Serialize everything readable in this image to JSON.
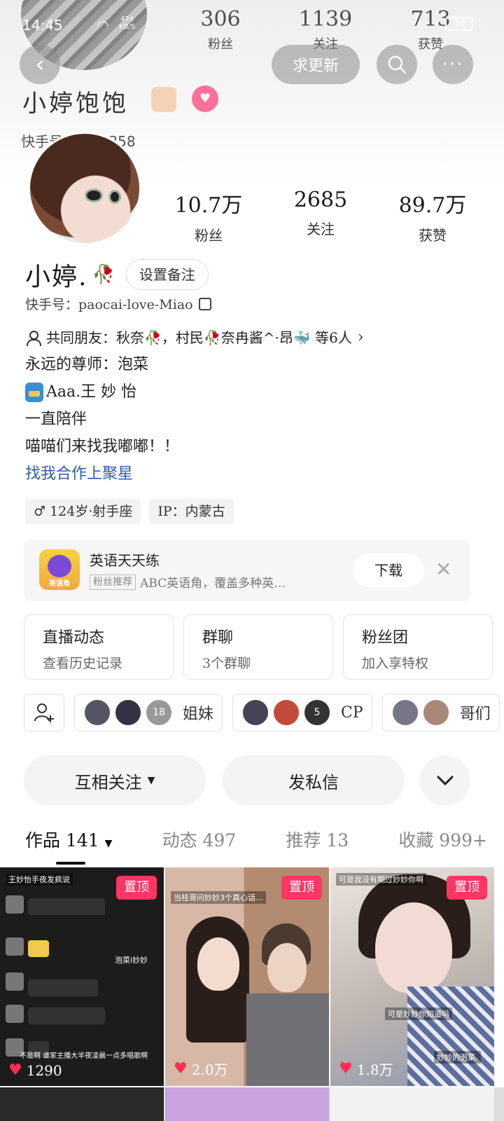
{
  "status_bar": {
    "time": "14:45",
    "speed_value": "424",
    "speed_unit": "KB/S",
    "battery": "36"
  },
  "header_bg": {
    "stats": [
      {
        "value": "306",
        "label": "粉丝"
      },
      {
        "value": "1139",
        "label": "关注"
      },
      {
        "value": "713",
        "label": "获赞"
      }
    ],
    "name": "小婷饱饱",
    "id_text": "快手号：…01358"
  },
  "nav": {
    "update_label": "求更新"
  },
  "profile": {
    "stats": [
      {
        "value": "10.7万",
        "label": "粉丝"
      },
      {
        "value": "2685",
        "label": "关注"
      },
      {
        "value": "89.7万",
        "label": "获赞"
      }
    ],
    "name": "小婷.",
    "remark_label": "设置备注",
    "kuaishou_id": "快手号：paocai-love-Miao"
  },
  "bio": {
    "mutual_friends": "共同朋友：秋奈🥀，村民🥀奈冉酱^·昂🐳 等6人",
    "lines": [
      "永远的尊师：泡菜",
      "Aaa.王 妙 怡",
      "一直陪伴",
      "喵喵们来找我嘟嘟！！"
    ],
    "link": "找我合作上聚星"
  },
  "tags": [
    "124岁·射手座",
    "IP：内蒙古"
  ],
  "ad": {
    "app_icon_label": "英语角",
    "title": "英语天天练",
    "badge": "粉丝推荐",
    "subtitle": "ABC英语角，覆盖多种英…",
    "download_label": "下载"
  },
  "cards": [
    {
      "title": "直播动态",
      "sub": "查看历史记录"
    },
    {
      "title": "群聊",
      "sub": "3个群聊"
    },
    {
      "title": "粉丝团",
      "sub": "加入享特权"
    }
  ],
  "chips": [
    {
      "label": "姐妹",
      "extra": "18"
    },
    {
      "label": "CP",
      "extra": "5"
    },
    {
      "label": "哥们"
    }
  ],
  "actions": {
    "follow_label": "互相关注",
    "dm_label": "发私信"
  },
  "tabs": [
    "作品 141",
    "动态 497",
    "推荐 13",
    "收藏 999+"
  ],
  "videos": [
    {
      "pin": "置顶",
      "likes": "1290",
      "caption": "王妙怡手夜发疯说",
      "bottom_text": "不是啊 谁家主播大半夜凌晨一点多唱歌啊",
      "tag": "泡菜i妙妙"
    },
    {
      "pin": "置顶",
      "likes": "2.0万",
      "caption": "当桂哥问妙妙3个真心话..."
    },
    {
      "pin": "置顶",
      "likes": "1.8万",
      "caption": "可是我没有糊过妙妙你啊",
      "mid_text": "可是妙妙你知道吗",
      "bottom_text": "妙妙的泡菜."
    }
  ],
  "colors": {
    "accent_pink": "#fe3666",
    "heart": "#fe2c55",
    "link_blue": "#2f5aa8"
  }
}
